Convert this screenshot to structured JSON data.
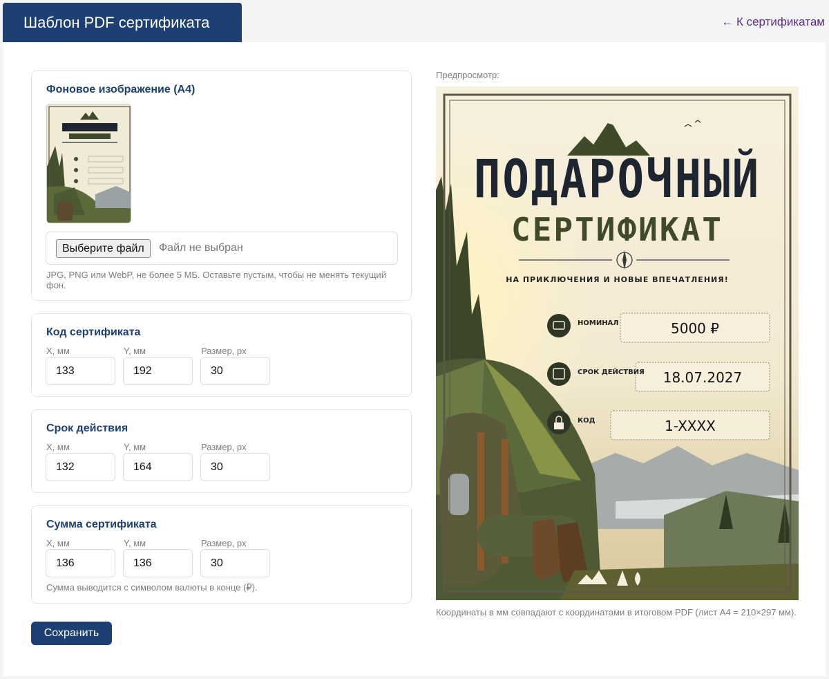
{
  "header": {
    "title": "Шаблон PDF сертификата",
    "back_link": "← К сертификатам"
  },
  "background": {
    "heading": "Фоновое изображение (A4)",
    "file_button": "Выберите файл",
    "file_status": "Файл не выбран",
    "hint": "JPG, PNG или WebP, не более 5 МБ. Оставьте пустым, чтобы не менять текущий фон."
  },
  "code": {
    "heading": "Код сертификата",
    "x_label": "X, мм",
    "x": "133",
    "y_label": "Y, мм",
    "y": "192",
    "size_label": "Размер, px",
    "size": "30"
  },
  "expiry": {
    "heading": "Срок действия",
    "x_label": "X, мм",
    "x": "132",
    "y_label": "Y, мм",
    "y": "164",
    "size_label": "Размер, px",
    "size": "30"
  },
  "amount": {
    "heading": "Сумма сертификата",
    "x_label": "X, мм",
    "x": "136",
    "y_label": "Y, мм",
    "y": "136",
    "size_label": "Размер, px",
    "size": "30",
    "hint": "Сумма выводится с символом валюты в конце (₽)."
  },
  "save_label": "Сохранить",
  "preview": {
    "label": "Предпросмотр:",
    "note": "Координаты в мм совпадают с координатами в итоговом PDF (лист A4 = 210×297 мм).",
    "cert": {
      "line1": "ПОДАРОЧНЫЙ",
      "line2": "СЕРТИФИКАТ",
      "tagline": "НА ПРИКЛЮЧЕНИЯ И НОВЫЕ ВПЕЧАТЛЕНИЯ!",
      "row1_label": "НОМИНАЛ",
      "row2_label": "СРОК ДЕЙСТВИЯ",
      "row3_label": "КОД",
      "amount_value": "5000 ₽",
      "expiry_value": "18.07.2027",
      "code_value": "1-XXXX"
    }
  },
  "colors": {
    "primary": "#1d3f72",
    "link": "#5a2d82",
    "cert_dark": "#1e2530",
    "cert_green": "#3e4a2a",
    "cert_bg": "#f6efdd"
  }
}
